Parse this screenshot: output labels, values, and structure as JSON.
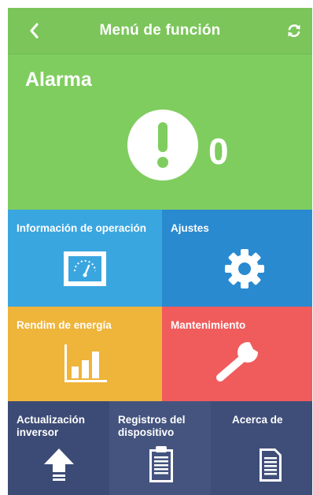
{
  "header": {
    "title": "Menú de función",
    "back_icon": "chevron-left-icon",
    "refresh_icon": "refresh-icon"
  },
  "alarm": {
    "label": "Alarma",
    "count": "0",
    "icon": "exclamation-circle-icon"
  },
  "tiles": [
    {
      "label": "Información de operación",
      "icon": "meter-icon",
      "color": "#3aa6e0"
    },
    {
      "label": "Ajustes",
      "icon": "gear-icon",
      "color": "#2a8ad0"
    },
    {
      "label": "Rendim de energía",
      "icon": "bar-chart-icon",
      "color": "#efb43a"
    },
    {
      "label": "Mantenimiento",
      "icon": "wrench-icon",
      "color": "#f05c5c"
    },
    {
      "label": "Actualización inversor",
      "icon": "upload-arrow-icon",
      "color": "#3c4b75"
    },
    {
      "label": "Registros del dispositivo",
      "icon": "clipboard-icon",
      "color": "#44547f"
    },
    {
      "label": "Acerca de",
      "icon": "document-icon",
      "color": "#3f4e79"
    }
  ],
  "colors": {
    "header_green": "#7bc55a",
    "alarm_green": "#7fcd5f"
  }
}
